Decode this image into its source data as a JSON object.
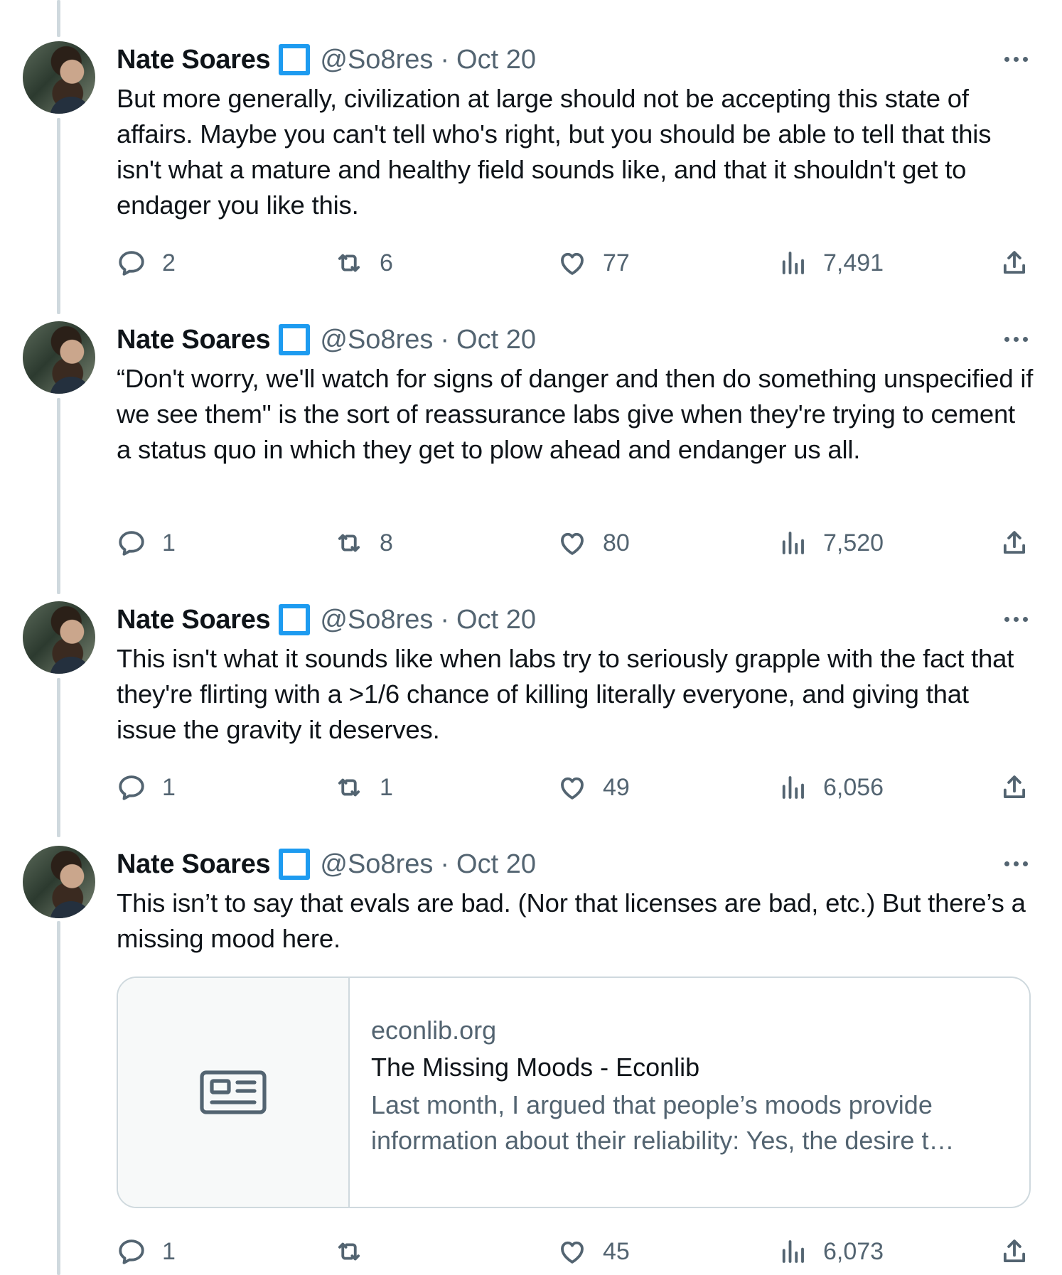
{
  "tweets": [
    {
      "author": {
        "name": "Nate Soares",
        "handle": "@So8res",
        "date": "Oct 20"
      },
      "text": "But more generally, civilization at large should not be accepting this state of affairs. Maybe you can't tell who's right, but you should be able to tell that this isn't what a mature and healthy field sounds like, and that it shouldn't get to endager you like this.",
      "stats": {
        "replies": "2",
        "retweets": "6",
        "likes": "77",
        "views": "7,491"
      }
    },
    {
      "author": {
        "name": "Nate Soares",
        "handle": "@So8res",
        "date": "Oct 20"
      },
      "text": "“Don't worry, we'll watch for signs of danger and then do something unspecified if we see them\" is the sort of reassurance labs give when they're trying to cement a status quo in which they get to plow ahead and endanger us all.",
      "stats": {
        "replies": "1",
        "retweets": "8",
        "likes": "80",
        "views": "7,520"
      }
    },
    {
      "author": {
        "name": "Nate Soares",
        "handle": "@So8res",
        "date": "Oct 20"
      },
      "text": "This isn't what it sounds like when labs try to seriously grapple with the fact that they're flirting with a >1/6 chance of killing literally everyone, and giving that issue the gravity it deserves.",
      "stats": {
        "replies": "1",
        "retweets": "1",
        "likes": "49",
        "views": "6,056"
      }
    },
    {
      "author": {
        "name": "Nate Soares",
        "handle": "@So8res",
        "date": "Oct 20"
      },
      "text": "This isn’t to say that evals are bad. (Nor that licenses are bad, etc.) But there’s a missing mood here.",
      "card": {
        "domain": "econlib.org",
        "title": "The Missing Moods - Econlib",
        "description": "Last month, I argued that people’s moods provide information about their reliability: Yes, the desire t…",
        "icon": "article-icon"
      },
      "stats": {
        "replies": "1",
        "retweets": "",
        "likes": "45",
        "views": "6,073"
      }
    }
  ],
  "separator": "·",
  "icons": {
    "reply": "reply-icon",
    "retweet": "retweet-icon",
    "like": "heart-icon",
    "views": "views-icon",
    "share": "share-icon",
    "more": "more-icon",
    "verified": "verified-badge-icon"
  },
  "colors": {
    "text": "#0f1419",
    "secondary": "#536471",
    "border": "#cfd9de",
    "badge": "#1d9bf0"
  }
}
